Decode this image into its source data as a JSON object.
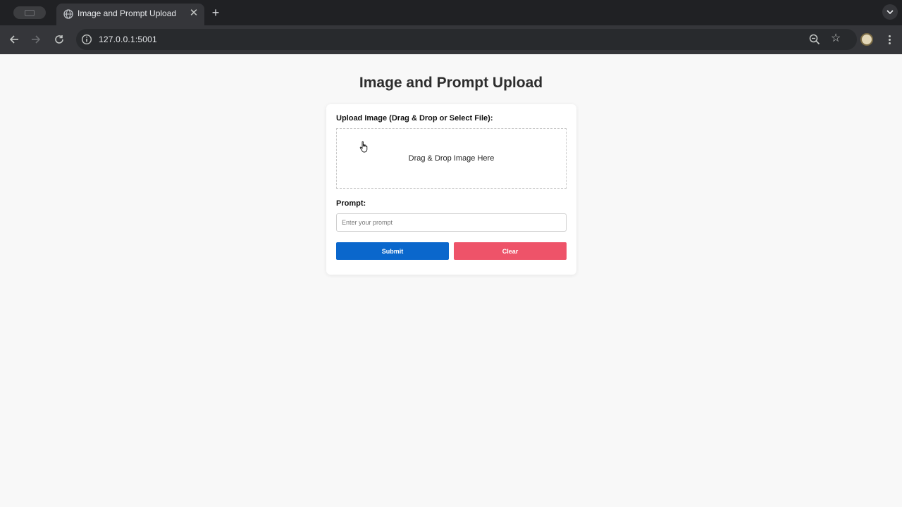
{
  "browser": {
    "tab_title": "Image and Prompt Upload",
    "url": "127.0.0.1:5001",
    "icons": {
      "tab_search": "tab-search-icon",
      "favicon": "globe-icon",
      "tab_close": "close-icon",
      "new_tab": "plus-icon",
      "tab_menu": "chevron-down-icon",
      "back": "arrow-left-icon",
      "forward": "arrow-right-icon",
      "reload": "reload-icon",
      "site_info": "info-icon",
      "zoom": "zoom-icon",
      "bookmark": "star-icon",
      "profile": "avatar",
      "menu": "kebab-menu-icon"
    }
  },
  "page": {
    "title": "Image and Prompt Upload",
    "upload_label": "Upload Image (Drag & Drop or Select File):",
    "dropzone_text": "Drag & Drop Image Here",
    "prompt_label": "Prompt:",
    "prompt_placeholder": "Enter your prompt",
    "prompt_value": "",
    "submit_label": "Submit",
    "clear_label": "Clear"
  },
  "colors": {
    "submit": "#0a67cc",
    "clear": "#ee5369",
    "page_background": "#f8f8f8",
    "browser_frame": "#202124"
  }
}
